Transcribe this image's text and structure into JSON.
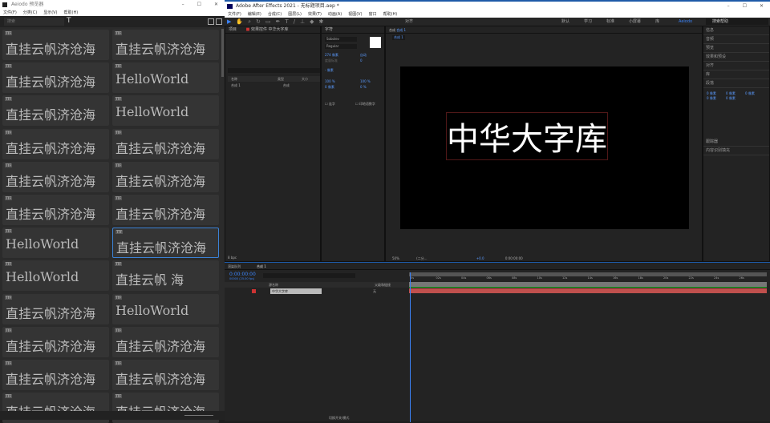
{
  "left_window": {
    "title": "Aeiodo 预览器",
    "menu": [
      "文件(F)",
      "分类(C)",
      "显示(V)",
      "帮助(H)"
    ],
    "search_placeholder": "搜索",
    "text_icon": "T",
    "tag": "TTF",
    "cards": [
      "直挂云帆济沧海",
      "直挂云帆济沧海",
      "直挂云帆济沧海",
      "HelloWorld",
      "直挂云帆济沧海",
      "HelloWorld",
      "直挂云帆济沧海",
      "直挂云帆济沧海",
      "直挂云帆济沧海",
      "直挂云帆济沧海",
      "直挂云帆济沧海",
      "直挂云帆济沧海",
      "HelloWorld",
      "直挂云帆济沧海",
      "HelloWorld",
      "直挂云帆    海",
      "直挂云帆济沧海",
      "HelloWorld",
      "直挂云帆济沧海",
      "直挂云帆济沧海",
      "直挂云帆济沧海",
      "直挂云帆济沧海",
      "直挂云帆济沧海",
      "直挂云帆济沧海"
    ],
    "selected_index": 13
  },
  "ae": {
    "title": "Adobe After Effects 2021 - 无标题项目.aep *",
    "menu": [
      "文件(F)",
      "编辑(E)",
      "合成(C)",
      "图层(L)",
      "效果(T)",
      "动画(A)",
      "视图(V)",
      "窗口",
      "帮助(H)"
    ],
    "toolbar": {
      "align": "对齐",
      "workspaces": [
        "默认",
        "学习",
        "标准",
        "小屏幕",
        "库"
      ],
      "active_ws": "Aeiodo",
      "search_help": "搜索帮助"
    },
    "project": {
      "tab": "项目",
      "effects_tab": "效果控件 中华大字库",
      "col_name": "名称",
      "col_type": "类型",
      "col_size": "大小",
      "item_name": "合成 1",
      "item_type": "合成",
      "bpc": "8 bpc"
    },
    "character": {
      "tab": "字符",
      "font": "Sobolev",
      "style": "Regular",
      "size": "274 像素",
      "leading": "自动",
      "tracking_label": "度量标准",
      "tracking": "0",
      "stroke": "- 像素",
      "vscale": "100 %",
      "hscale": "100 %",
      "baseline": "0 像素",
      "tsume": "0 %",
      "ligatures": "连字",
      "hindi": "印地语数字"
    },
    "comp": {
      "tab": "合成",
      "comp_name": "合成 1",
      "breadcrumb": "合成 1",
      "text": "中华大字库",
      "zoom": "50%",
      "resolution": "(二分...",
      "exposure": "+0.0",
      "time": "0:00:00:00"
    },
    "right_panel": [
      "信息",
      "音频",
      "预览",
      "效果和预设",
      "对齐",
      "库",
      "段落",
      "跟踪器",
      "内容识别填充"
    ],
    "para": {
      "vals": [
        "0 像素",
        "0 像素",
        "0 像素",
        "0 像素",
        "0 像素"
      ]
    },
    "timeline": {
      "render_tab": "渲染队列",
      "comp_tab": "合成 1",
      "time": "0:00:00:00",
      "fps": "00000 (25.00 fps)",
      "col_layer": "源名称",
      "col_parent": "父级和链接",
      "layer_name": "中华大字库",
      "parent": "无",
      "ticks": [
        "0s",
        "02s",
        "04s",
        "06s",
        "08s",
        "10s",
        "12s",
        "14s",
        "16s",
        "18s",
        "20s",
        "22s",
        "24s",
        "26s"
      ],
      "toggle": "切换开关/模式"
    }
  }
}
